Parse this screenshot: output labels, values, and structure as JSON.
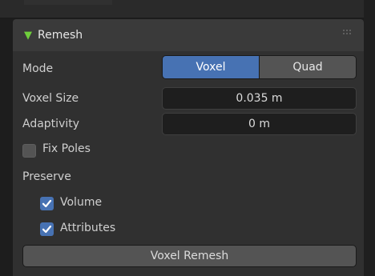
{
  "panel": {
    "title": "Remesh",
    "mode": {
      "label": "Mode",
      "options": [
        "Voxel",
        "Quad"
      ],
      "selected": "Voxel"
    },
    "voxel_size": {
      "label": "Voxel Size",
      "value": "0.035 m"
    },
    "adaptivity": {
      "label": "Adaptivity",
      "value": "0 m"
    },
    "fix_poles": {
      "label": "Fix Poles",
      "checked": false
    },
    "preserve": {
      "label": "Preserve",
      "volume": {
        "label": "Volume",
        "checked": true
      },
      "attributes": {
        "label": "Attributes",
        "checked": true
      }
    },
    "action_button": "Voxel Remesh"
  },
  "colors": {
    "accent": "#4772b3",
    "panel_bg": "#303030",
    "header_bg": "#3a3a3a",
    "button_bg": "#545454",
    "field_bg": "#1e1e1e",
    "expand_triangle": "#6fce3c"
  },
  "icons": {
    "expand": "triangle-down-icon",
    "drag": "drag-grip-icon",
    "check": "checkmark-icon"
  }
}
